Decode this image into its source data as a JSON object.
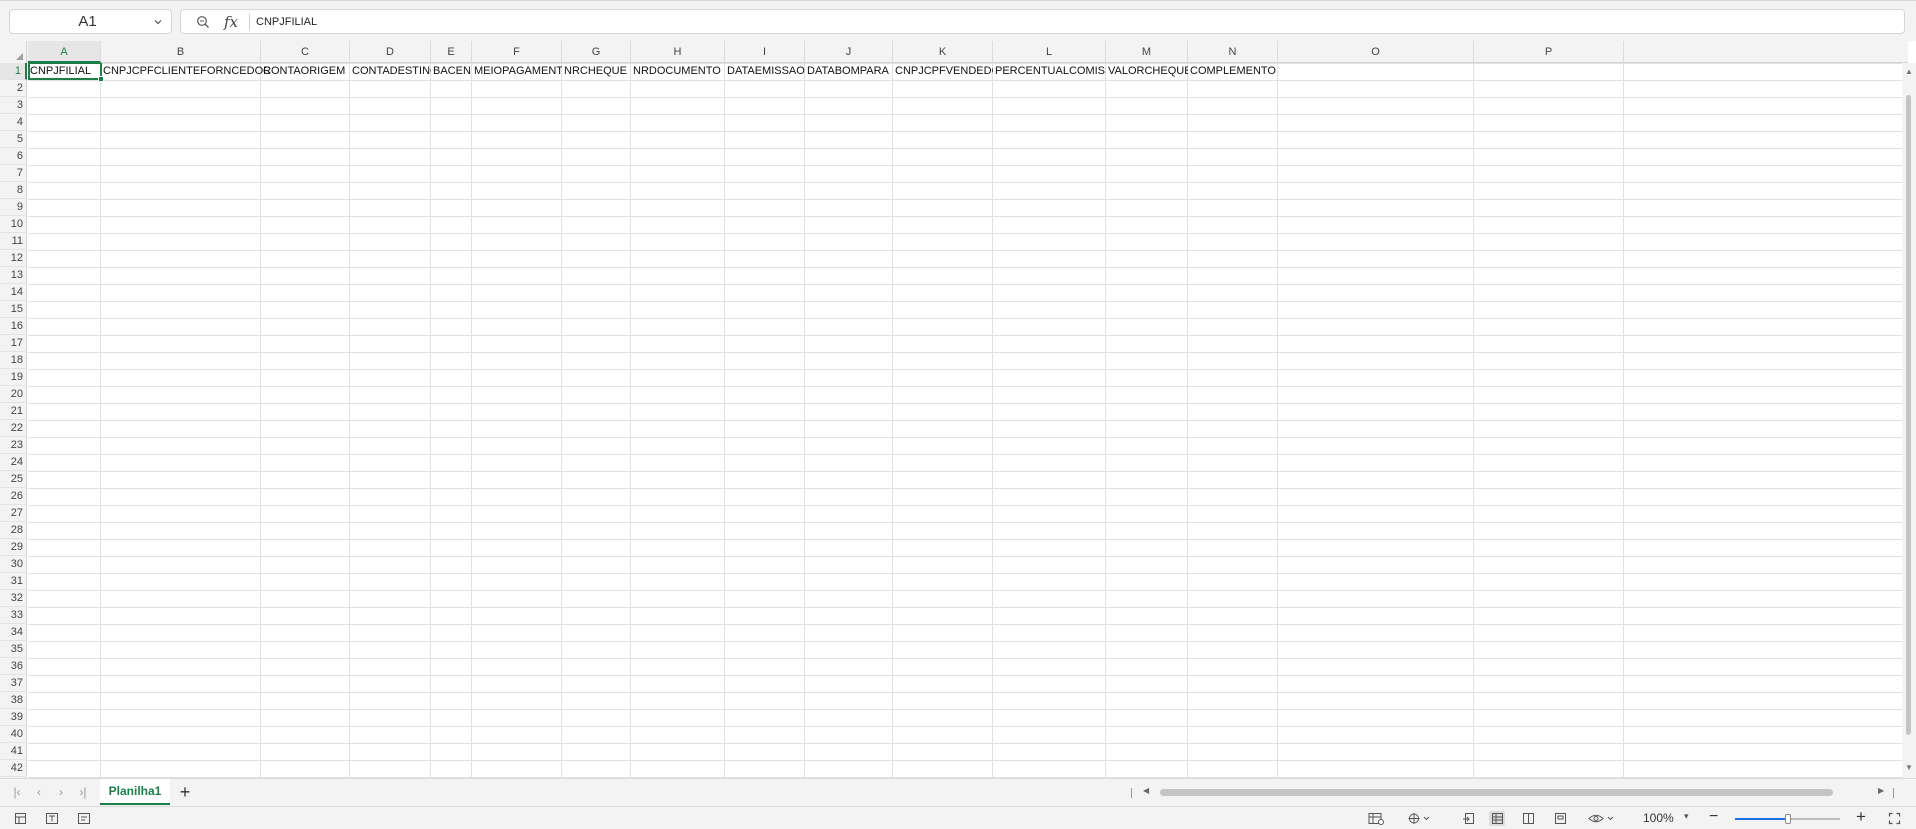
{
  "formula_bar": {
    "name_box": "A1",
    "fx_label": "fx",
    "value": "CNPJFILIAL"
  },
  "grid": {
    "columns": [
      "A",
      "B",
      "C",
      "D",
      "E",
      "F",
      "G",
      "H",
      "I",
      "J",
      "K",
      "L",
      "M",
      "N",
      "O",
      "P"
    ],
    "active_column": "A",
    "active_row": 1,
    "rows": [
      "1",
      "2",
      "3",
      "4",
      "5",
      "6",
      "7",
      "8",
      "9",
      "10",
      "11",
      "12",
      "13",
      "14",
      "15",
      "16",
      "17",
      "18",
      "19",
      "20",
      "21",
      "22",
      "23",
      "24",
      "25",
      "26",
      "27",
      "28",
      "29",
      "30",
      "31",
      "32",
      "33",
      "34",
      "35",
      "36",
      "37",
      "38",
      "39",
      "40",
      "41",
      "42"
    ],
    "row1_values": [
      "CNPJFILIAL",
      "CNPJCPFCLIENTEFORNCEDOR",
      "CONTAORIGEM",
      "CONTADESTINO",
      "BACEN",
      "MEIOPAGAMENTO",
      "NRCHEQUE",
      "NRDOCUMENTO",
      "DATAEMISSAO",
      "DATABOMPARA",
      "CNPJCPFVENDEDOR",
      "PERCENTUALCOMISSAO",
      "VALORCHEQUE",
      "COMPLEMENTO",
      "",
      ""
    ]
  },
  "sheets": {
    "tabs": [
      "Planilha1"
    ],
    "active": "Planilha1",
    "add_label": "+"
  },
  "status": {
    "zoom": "100%",
    "zoom_level_fraction": 0.5
  },
  "colors": {
    "accent": "#1e7e4a",
    "zoom_slider": "#1a73e8"
  }
}
